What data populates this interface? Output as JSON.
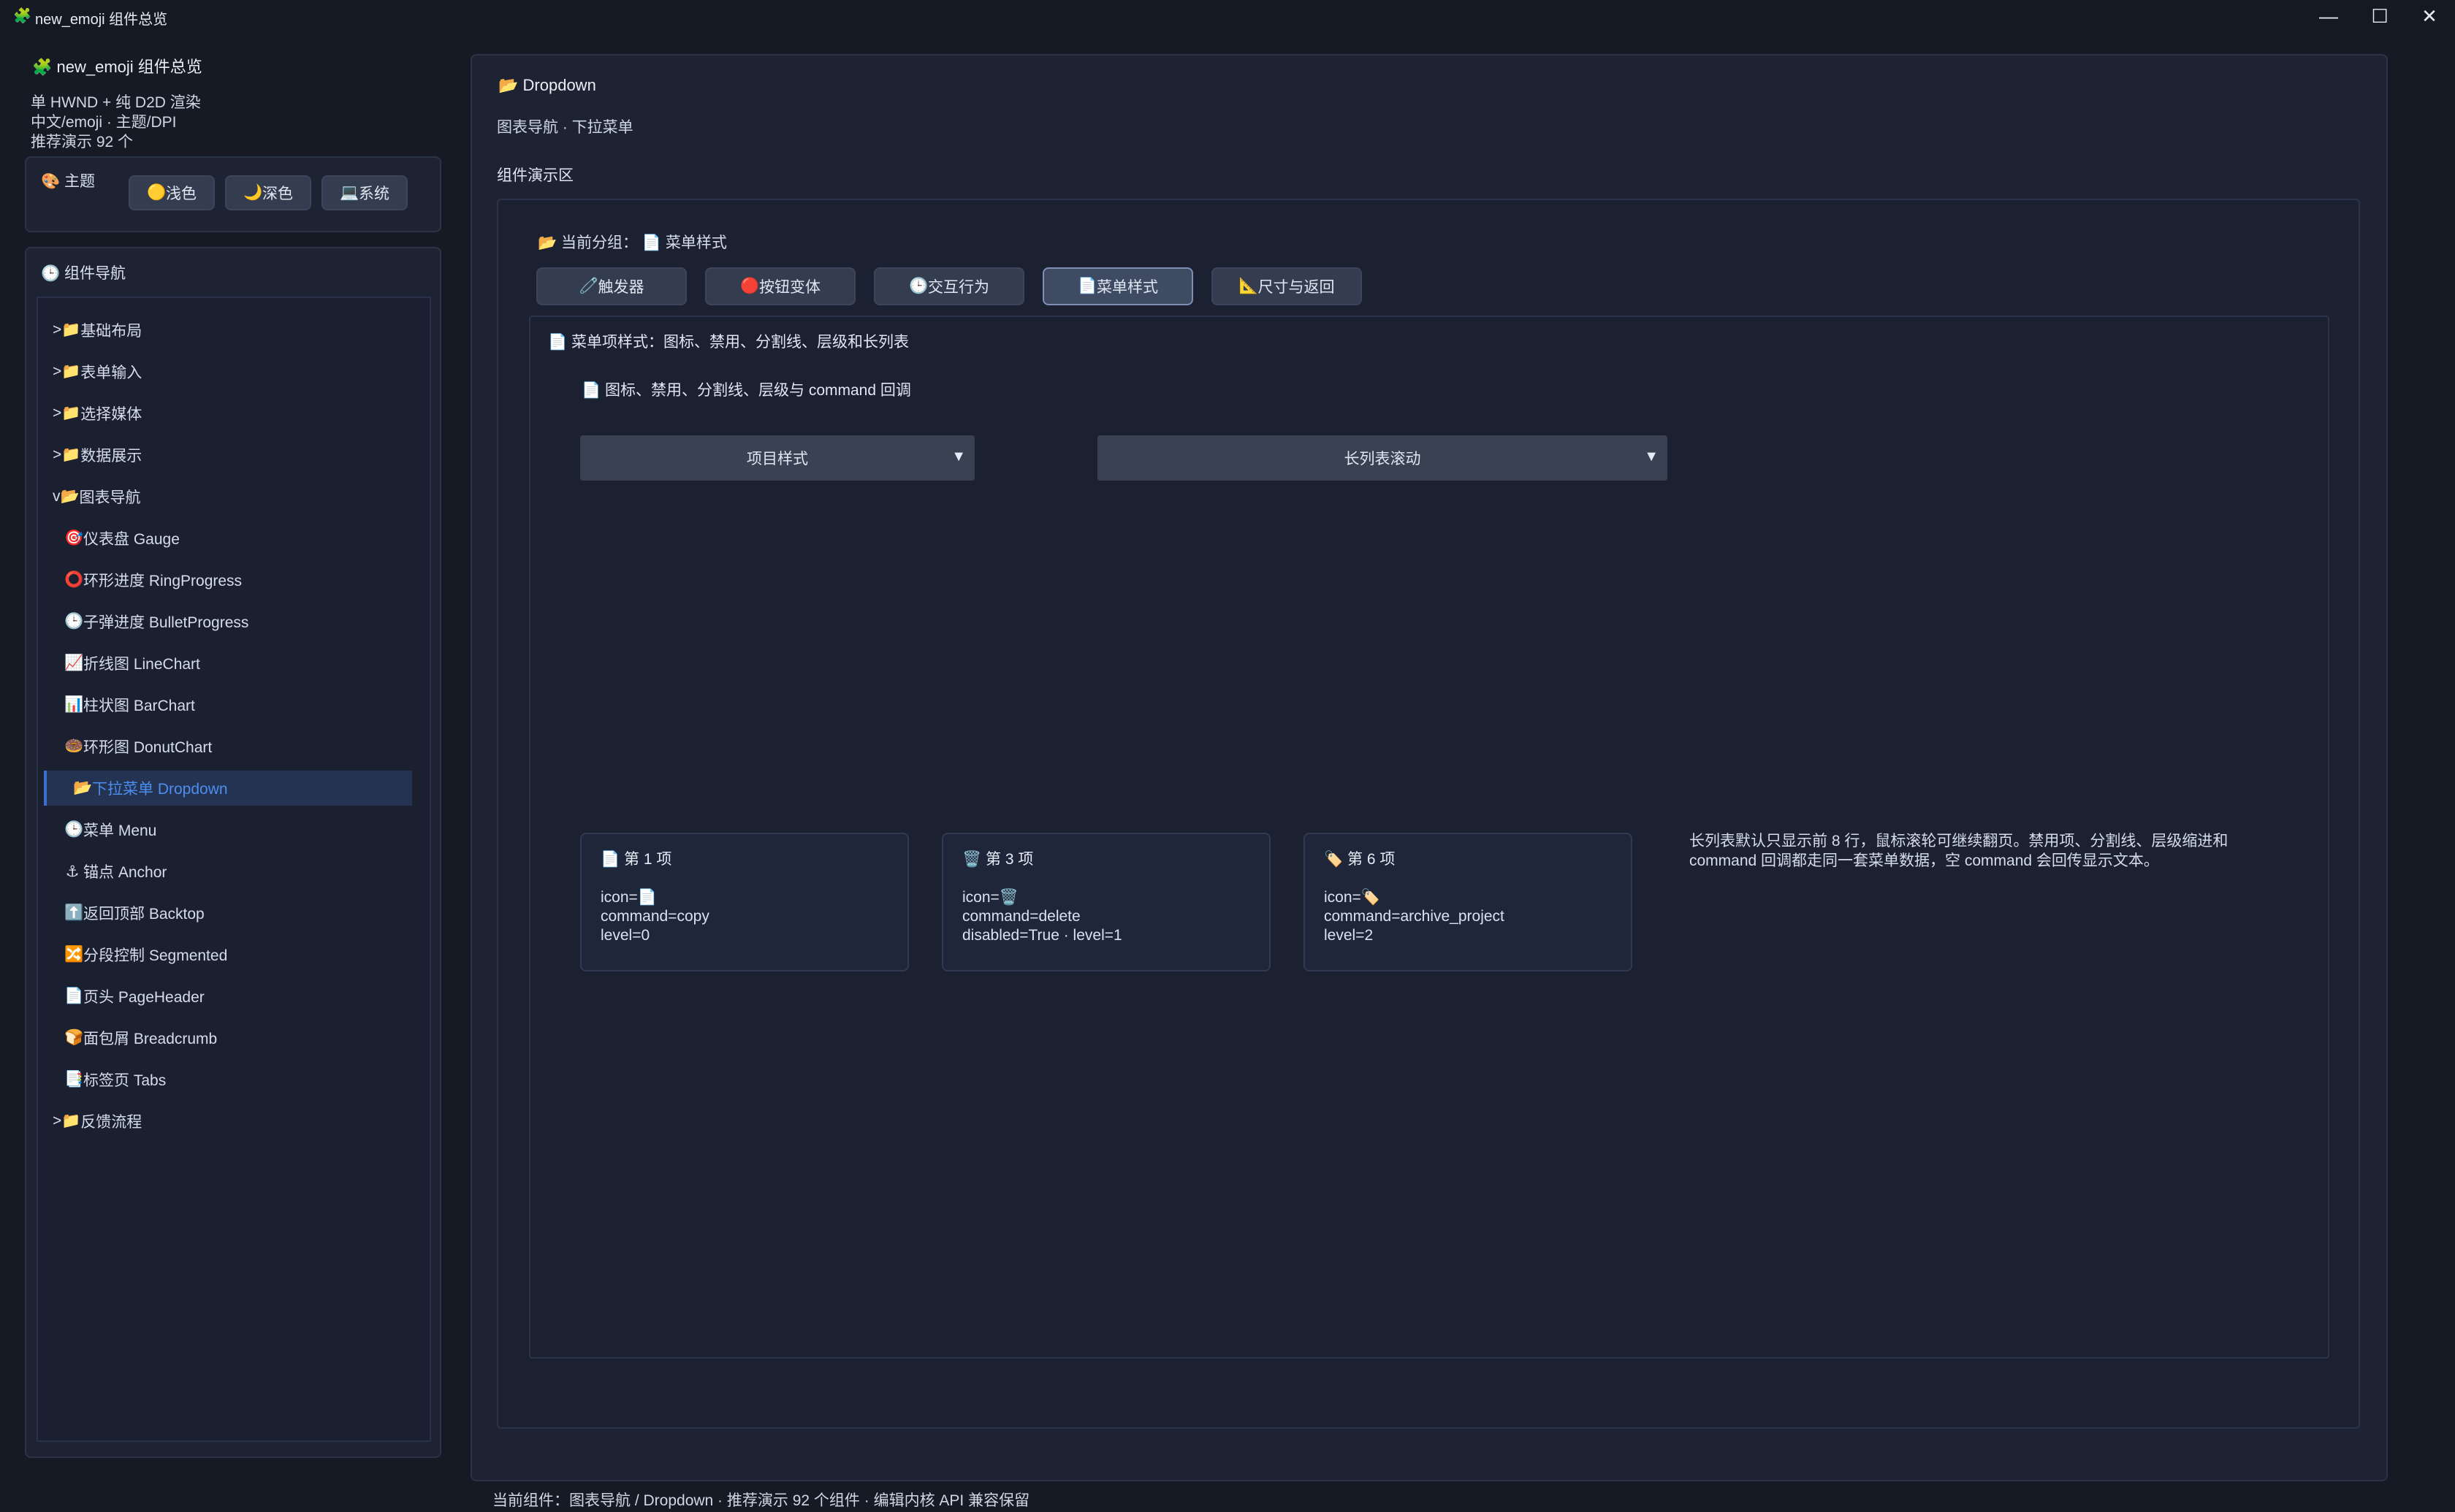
{
  "window": {
    "title": "new_emoji 组件总览",
    "controls": {
      "minimize": "—",
      "maximize": "☐",
      "close": "✕"
    }
  },
  "sidebar": {
    "title": "new_emoji 组件总览",
    "info_lines": [
      "单 HWND + 纯 D2D 渲染",
      "中文/emoji · 主题/DPI",
      "推荐演示 92 个"
    ],
    "theme": {
      "label": "主题",
      "buttons": [
        {
          "icon": "🟡",
          "label": "浅色"
        },
        {
          "icon": "🌙",
          "label": "深色"
        },
        {
          "icon": "💻",
          "label": "系统"
        }
      ]
    },
    "nav": {
      "title": "组件导航",
      "items": [
        {
          "prefix": ">",
          "icon": "📁",
          "label": "基础布局"
        },
        {
          "prefix": ">",
          "icon": "📁",
          "label": "表单输入"
        },
        {
          "prefix": ">",
          "icon": "📁",
          "label": "选择媒体"
        },
        {
          "prefix": ">",
          "icon": "📁",
          "label": "数据展示"
        },
        {
          "prefix": "v",
          "icon": "📂",
          "label": "图表导航"
        },
        {
          "icon": "🎯",
          "label": "仪表盘 Gauge"
        },
        {
          "icon": "⭕",
          "label": "环形进度 RingProgress"
        },
        {
          "icon": "🕒",
          "label": "子弹进度 BulletProgress"
        },
        {
          "icon": "📈",
          "label": "折线图 LineChart"
        },
        {
          "icon": "📊",
          "label": "柱状图 BarChart"
        },
        {
          "icon": "🍩",
          "label": "环形图 DonutChart"
        },
        {
          "icon": "📂",
          "label": "下拉菜单 Dropdown"
        },
        {
          "icon": "🕒",
          "label": "菜单 Menu"
        },
        {
          "icon": "⚓",
          "label": "锚点 Anchor"
        },
        {
          "icon": "⬆️",
          "label": "返回顶部 Backtop"
        },
        {
          "icon": "🔀",
          "label": "分段控制 Segmented"
        },
        {
          "icon": "📄",
          "label": "页头 PageHeader"
        },
        {
          "icon": "🍞",
          "label": "面包屑 Breadcrumb"
        },
        {
          "icon": "📑",
          "label": "标签页 Tabs"
        },
        {
          "prefix": ">",
          "icon": "📁",
          "label": "反馈流程"
        }
      ]
    }
  },
  "main": {
    "title": "Dropdown",
    "title_icon": "📂",
    "subtitle": "图表导航 · 下拉菜单",
    "demo_label": "组件演示区",
    "group_label": "当前分组：",
    "group_value": "菜单样式",
    "group_icon": "📂",
    "group_value_icon": "📄",
    "tabs": [
      {
        "icon": "🧷",
        "label": "触发器"
      },
      {
        "icon": "🔴",
        "label": "按钮变体"
      },
      {
        "icon": "🕒",
        "label": "交互行为"
      },
      {
        "icon": "📄",
        "label": "菜单样式"
      },
      {
        "icon": "📐",
        "label": "尺寸与返回"
      }
    ],
    "section_title": "菜单项样式：图标、禁用、分割线、层级和长列表",
    "section_subtitle": "图标、禁用、分割线、层级与 command 回调",
    "dropdowns": [
      {
        "value": "项目样式",
        "arrow": "▼"
      },
      {
        "value": "长列表滚动",
        "arrow": "▼"
      }
    ],
    "cards": [
      {
        "title": "第 1 项",
        "icon": "📄",
        "lines": [
          "icon=📄",
          "command=copy",
          "level=0"
        ]
      },
      {
        "title": "第 3 项",
        "icon": "🗑️",
        "lines": [
          "icon=🗑️",
          "command=delete",
          "disabled=True · level=1"
        ]
      },
      {
        "title": "第 6 项",
        "icon": "🏷️",
        "lines": [
          "icon=🏷️",
          "command=archive_project",
          "level=2"
        ]
      }
    ],
    "note": "长列表默认只显示前 8 行，鼠标滚轮可继续翻页。禁用项、分割线、层级缩进和 command 回调都走同一套菜单数据，空 command 会回传显示文本。"
  },
  "status_bar": "当前组件：图表导航 / Dropdown · 推荐演示 92 个组件 · 编辑内核 API 兼容保留",
  "colors": {
    "background": "#151a24",
    "panel": "#1d2333",
    "accent": "#3b6fd0",
    "selected_text": "#4b8ef0"
  }
}
